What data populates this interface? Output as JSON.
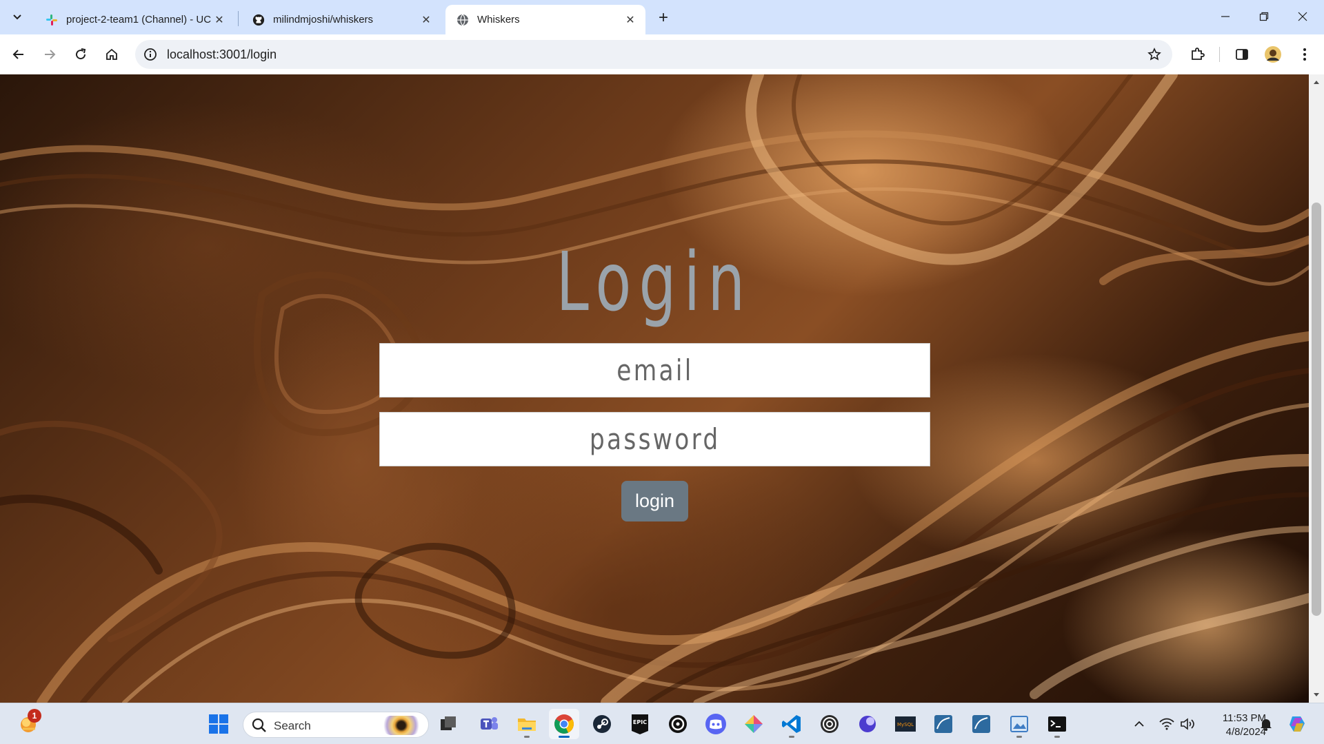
{
  "browser": {
    "tabs": [
      {
        "title": "project-2-team1 (Channel) - UC",
        "favicon": "slack-icon",
        "active": false
      },
      {
        "title": "milindmjoshi/whiskers",
        "favicon": "github-icon",
        "active": false
      },
      {
        "title": "Whiskers",
        "favicon": "globe-icon",
        "active": true
      }
    ],
    "url": "localhost:3001/login"
  },
  "page": {
    "title": "Login",
    "email_placeholder": "email",
    "password_placeholder": "password",
    "login_button": "login"
  },
  "taskbar": {
    "search_label": "Search",
    "weather_badge": "1",
    "time": "11:53 PM",
    "date": "4/8/2024",
    "pinned": [
      "file-explorer-icon",
      "teams-icon",
      "folder-icon",
      "chrome-icon",
      "steam-icon",
      "epic-games-icon",
      "ubisoft-icon",
      "discord-icon",
      "git-icon",
      "vscode-icon",
      "obs-icon",
      "fluent-icon",
      "mysql-icon",
      "workbench-icon",
      "workbench-icon",
      "paint-icon",
      "terminal-icon"
    ]
  },
  "colors": {
    "accent": "#0067c0",
    "button": "#6a7883",
    "title": "#9aa3ab"
  }
}
